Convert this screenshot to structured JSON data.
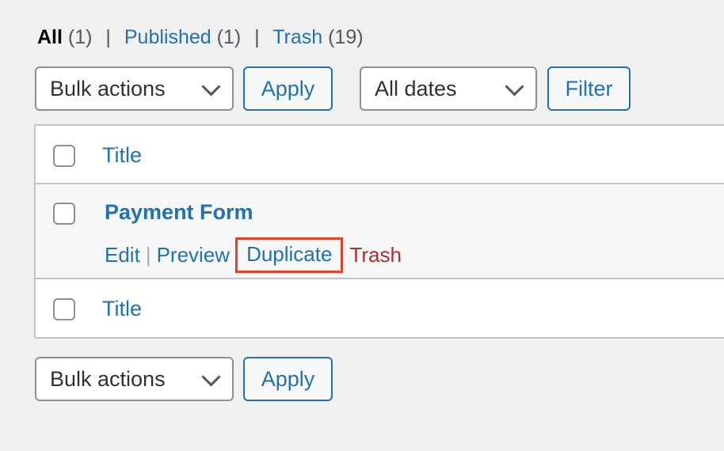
{
  "views": [
    {
      "label": "All",
      "count": "(1)",
      "current": true
    },
    {
      "label": "Published",
      "count": "(1)",
      "current": false
    },
    {
      "label": "Trash",
      "count": "(19)",
      "current": false
    }
  ],
  "separator": "|",
  "top_nav": {
    "bulk_actions": {
      "selected": "Bulk actions"
    },
    "apply_label": "Apply",
    "dates": {
      "selected": "All dates"
    },
    "filter_label": "Filter"
  },
  "table": {
    "column_title": "Title",
    "rows": [
      {
        "title": "Payment Form",
        "actions": {
          "edit": "Edit",
          "preview": "Preview",
          "duplicate": "Duplicate",
          "trash": "Trash"
        },
        "highlighted_action": "duplicate",
        "highlight_color": "#e8412a"
      }
    ]
  },
  "bottom_nav": {
    "bulk_actions": {
      "selected": "Bulk actions"
    },
    "apply_label": "Apply"
  },
  "colors": {
    "link": "#2271b1",
    "trash": "#b32d2e",
    "background": "#f0f0f1"
  }
}
